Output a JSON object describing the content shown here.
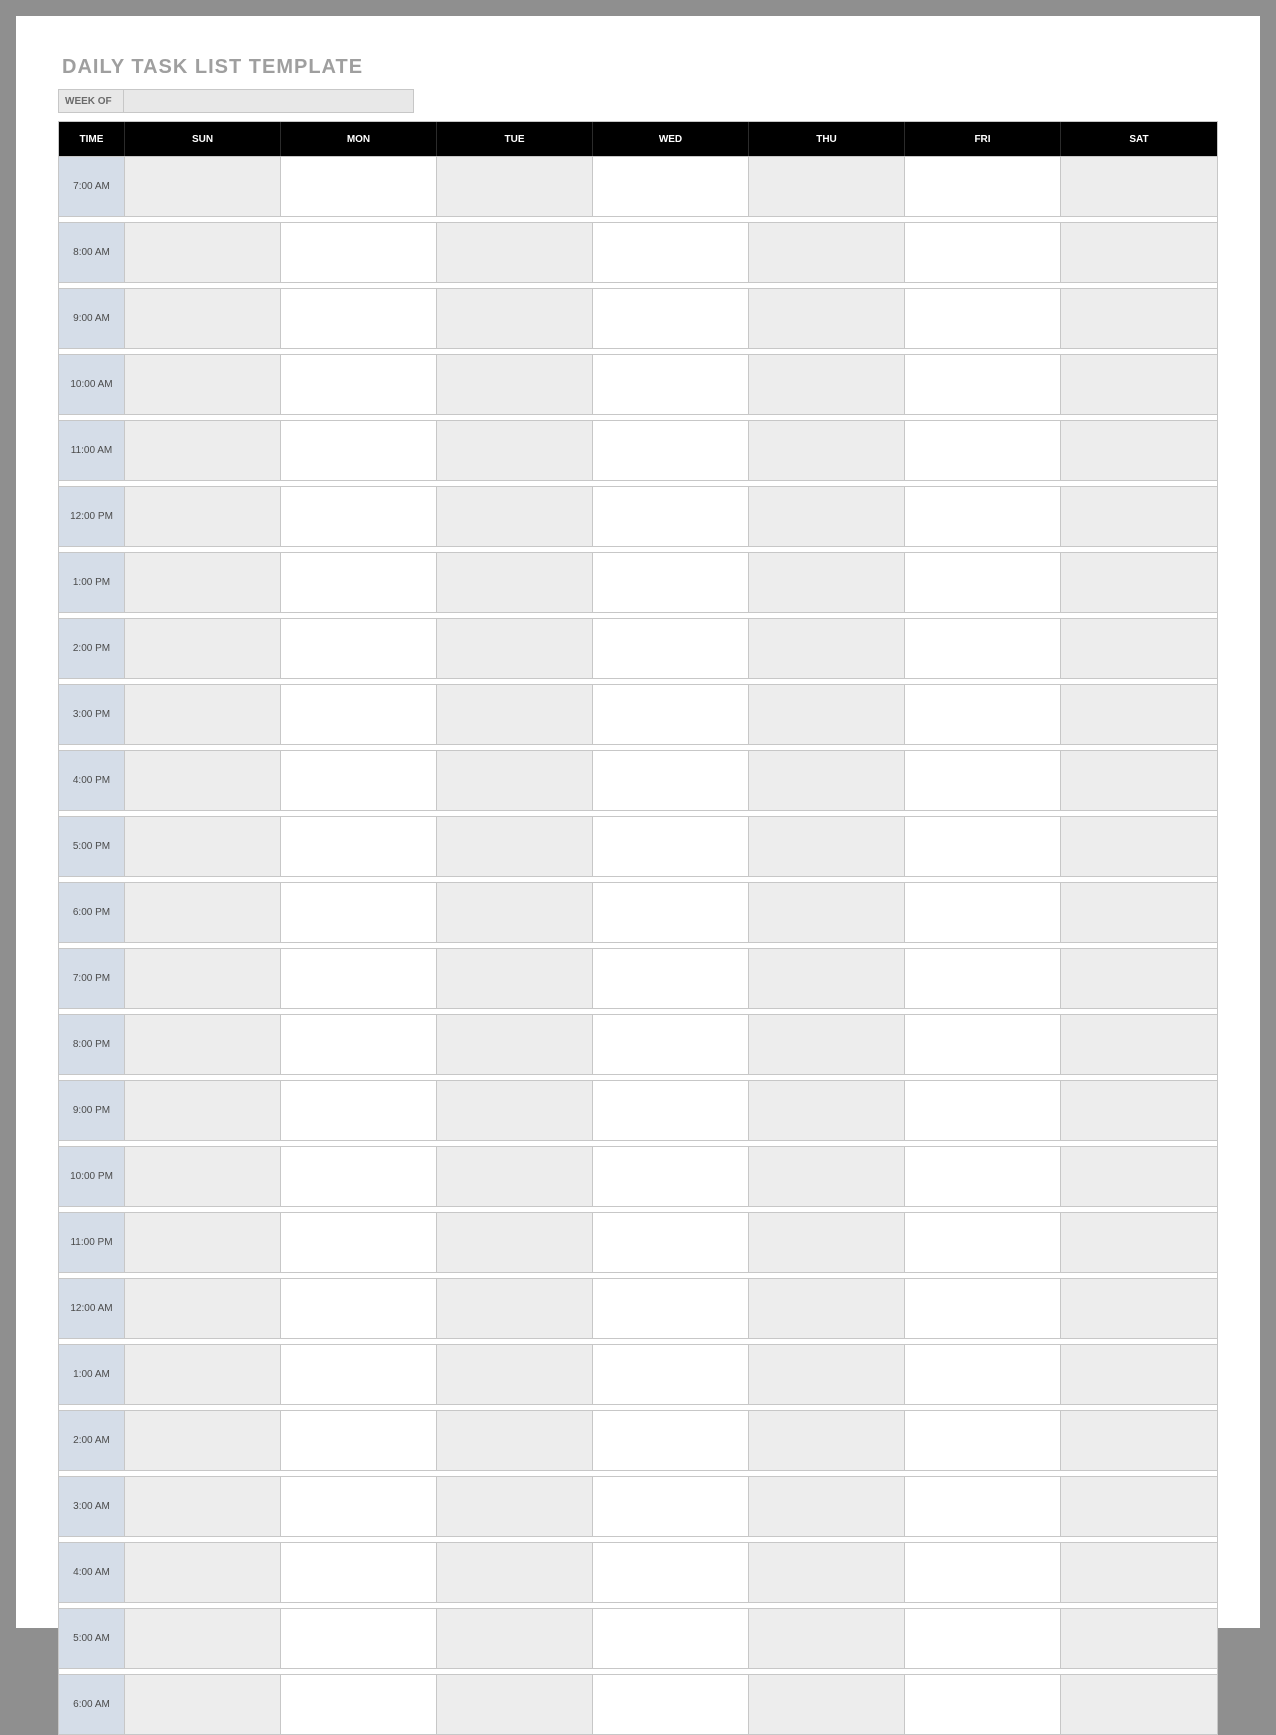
{
  "title": "DAILY TASK LIST TEMPLATE",
  "week_of_label": "WEEK OF",
  "week_of_value": "",
  "headers": {
    "time": "TIME",
    "days": [
      "SUN",
      "MON",
      "TUE",
      "WED",
      "THU",
      "FRI",
      "SAT"
    ]
  },
  "shaded_day_indexes": [
    0,
    2,
    4,
    6
  ],
  "times": [
    "7:00 AM",
    "8:00 AM",
    "9:00 AM",
    "10:00 AM",
    "11:00 AM",
    "12:00 PM",
    "1:00 PM",
    "2:00 PM",
    "3:00 PM",
    "4:00 PM",
    "5:00 PM",
    "6:00 PM",
    "7:00 PM",
    "8:00 PM",
    "9:00 PM",
    "10:00 PM",
    "11:00 PM",
    "12:00 AM",
    "1:00 AM",
    "2:00 AM",
    "3:00 AM",
    "4:00 AM",
    "5:00 AM",
    "6:00 AM"
  ],
  "cells": [
    [
      "",
      "",
      "",
      "",
      "",
      "",
      ""
    ],
    [
      "",
      "",
      "",
      "",
      "",
      "",
      ""
    ],
    [
      "",
      "",
      "",
      "",
      "",
      "",
      ""
    ],
    [
      "",
      "",
      "",
      "",
      "",
      "",
      ""
    ],
    [
      "",
      "",
      "",
      "",
      "",
      "",
      ""
    ],
    [
      "",
      "",
      "",
      "",
      "",
      "",
      ""
    ],
    [
      "",
      "",
      "",
      "",
      "",
      "",
      ""
    ],
    [
      "",
      "",
      "",
      "",
      "",
      "",
      ""
    ],
    [
      "",
      "",
      "",
      "",
      "",
      "",
      ""
    ],
    [
      "",
      "",
      "",
      "",
      "",
      "",
      ""
    ],
    [
      "",
      "",
      "",
      "",
      "",
      "",
      ""
    ],
    [
      "",
      "",
      "",
      "",
      "",
      "",
      ""
    ],
    [
      "",
      "",
      "",
      "",
      "",
      "",
      ""
    ],
    [
      "",
      "",
      "",
      "",
      "",
      "",
      ""
    ],
    [
      "",
      "",
      "",
      "",
      "",
      "",
      ""
    ],
    [
      "",
      "",
      "",
      "",
      "",
      "",
      ""
    ],
    [
      "",
      "",
      "",
      "",
      "",
      "",
      ""
    ],
    [
      "",
      "",
      "",
      "",
      "",
      "",
      ""
    ],
    [
      "",
      "",
      "",
      "",
      "",
      "",
      ""
    ],
    [
      "",
      "",
      "",
      "",
      "",
      "",
      ""
    ],
    [
      "",
      "",
      "",
      "",
      "",
      "",
      ""
    ],
    [
      "",
      "",
      "",
      "",
      "",
      "",
      ""
    ],
    [
      "",
      "",
      "",
      "",
      "",
      "",
      ""
    ],
    [
      "",
      "",
      "",
      "",
      "",
      "",
      ""
    ]
  ]
}
